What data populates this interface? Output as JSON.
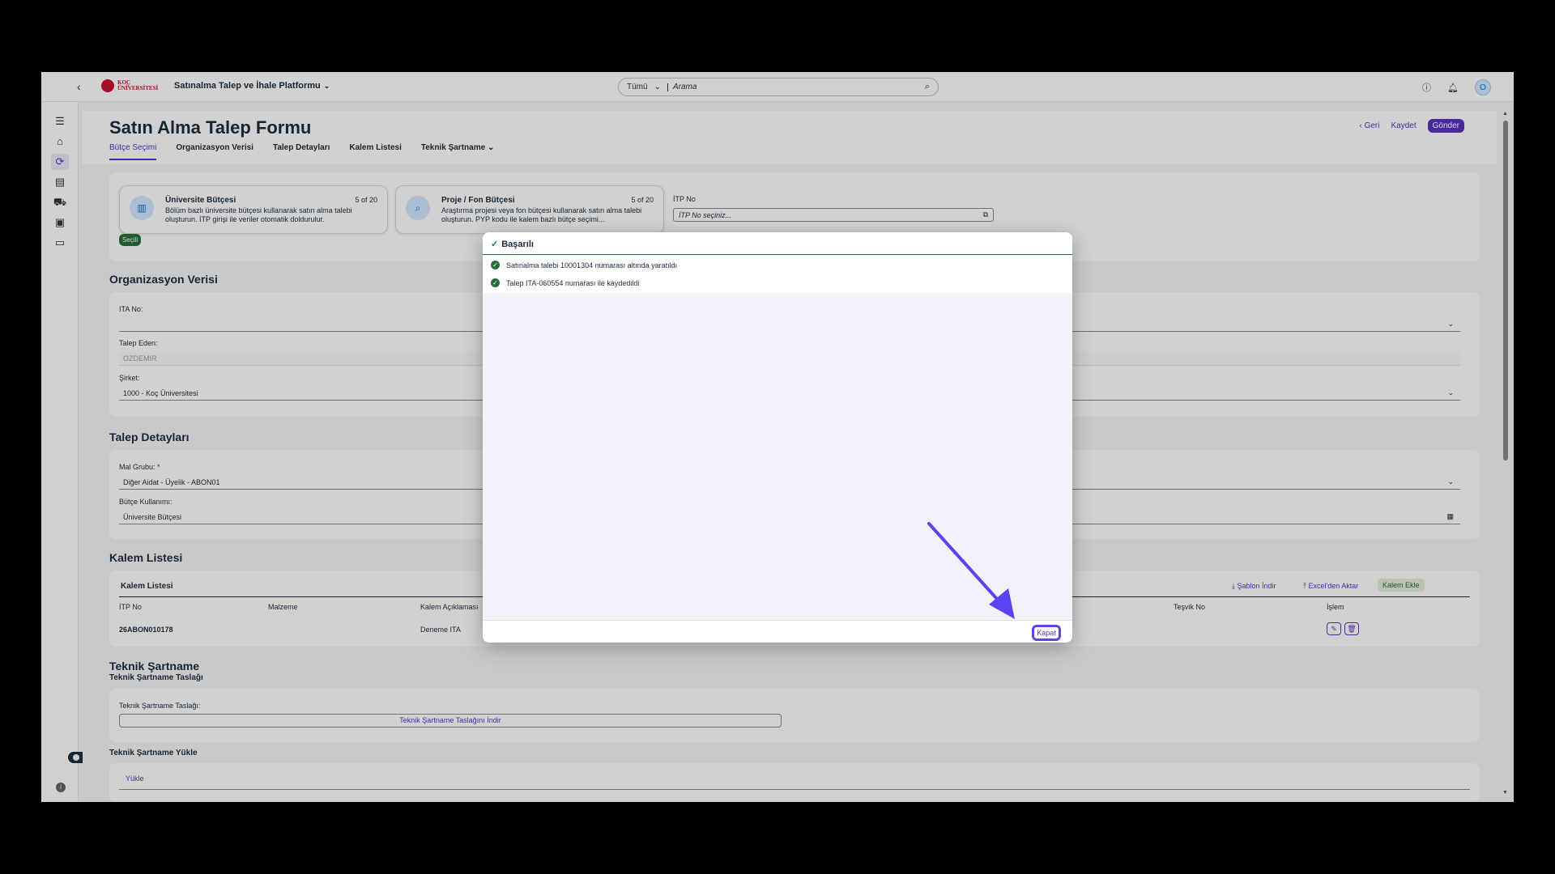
{
  "shell": {
    "logo_text_1": "KOÇ",
    "logo_text_2": "ÜNİVERSİTESİ",
    "app_title": "Satınalma Talep ve İhale Platformu",
    "search_scope": "Tümü",
    "search_placeholder": "Arama",
    "avatar_initial": "O"
  },
  "page": {
    "title": "Satın Alma Talep Formu",
    "back_label": "Geri",
    "save_label": "Kaydet",
    "submit_label": "Gönder",
    "tabs": [
      "Bütçe Seçimi",
      "Organizasyon Verisi",
      "Talep Detayları",
      "Kalem Listesi",
      "Teknik Şartname"
    ]
  },
  "budget": {
    "cards": [
      {
        "title": "Üniversite Bütçesi",
        "count": "5 of 20",
        "desc": "Bölüm bazlı üniversite bütçesi kullanarak satın alma talebi oluşturun. İTP girişi ile veriler otomatik doldurulur."
      },
      {
        "title": "Proje / Fon Bütçesi",
        "count": "5 of 20",
        "desc": "Araştırma projesi veya fon bütçesi kullanarak satın alma talebi oluşturun. PYP kodu ile kalem bazlı bütçe seçimi..."
      }
    ],
    "selected_badge": "Seçili",
    "itp_label": "İTP No",
    "itp_placeholder": "İTP No seçiniz..."
  },
  "org": {
    "title": "Organizasyon Verisi",
    "ita_label": "ITA No:",
    "requester_label": "Talep Eden:",
    "requester_value": "OZDEMIR",
    "company_label": "Şirket:",
    "company_value": "1000 - Koç Üniversitesi"
  },
  "details": {
    "title": "Talep Detayları",
    "material_group_label": "Mal Grubu:",
    "required_mark": "*",
    "material_group_value": "Diğer Aidat - Üyelik - ABON01",
    "budget_usage_label": "Bütçe Kullanımı:",
    "budget_usage_value": "Üniversite Bütçesi"
  },
  "items": {
    "title": "Kalem Listesi",
    "table_title": "Kalem Listesi",
    "download_template": "Şablon İndir",
    "excel_import": "Excel'den Aktar",
    "add_item": "Kalem Ekle",
    "columns": [
      "İTP No",
      "Malzeme",
      "Kalem Açıklaması",
      "Teşvik No",
      "İşlem"
    ],
    "rows": [
      {
        "itp": "26ABON010178",
        "material": "",
        "desc": "Deneme ITA"
      }
    ]
  },
  "tech": {
    "title": "Teknik Şartname",
    "draft_heading": "Teknik Şartname Taslağı",
    "draft_label": "Teknik Şartname Taslağı:",
    "download_draft": "Teknik Şartname Taslağını İndir",
    "upload_heading": "Teknik Şartname Yükle",
    "upload_label": "Yükle"
  },
  "dialog": {
    "title": "Başarılı",
    "messages": [
      "Satınalma talebi 10001304 numarası altında yaratıldı",
      "Talep ITA-060554 numarası ile kaydedildi"
    ],
    "close_label": "Kapat"
  },
  "colors": {
    "accent": "#5b33c1",
    "success": "#256f3a",
    "annotation_arrow": "#5b44f0"
  }
}
